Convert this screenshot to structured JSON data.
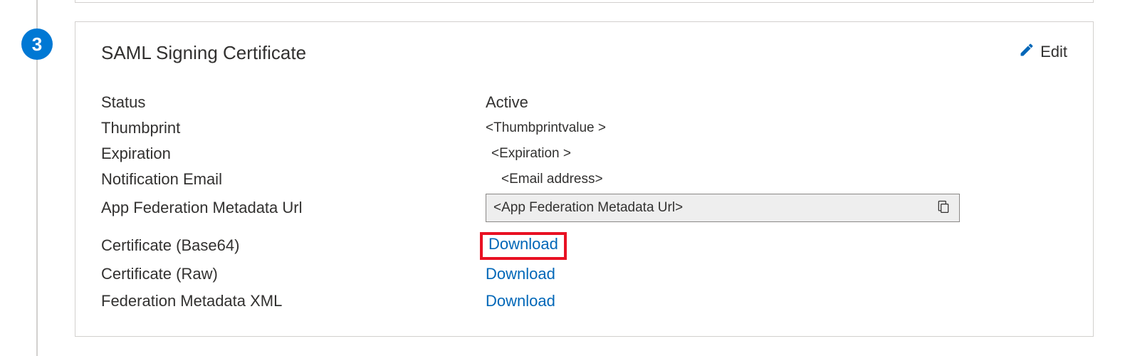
{
  "step": {
    "number": "3"
  },
  "card": {
    "title": "SAML Signing Certificate",
    "edit_label": "Edit"
  },
  "fields": {
    "status": {
      "label": "Status",
      "value": "Active"
    },
    "thumbprint": {
      "label": "Thumbprint",
      "value": "<Thumbprintvalue >"
    },
    "expiration": {
      "label": "Expiration",
      "value": "<Expiration >"
    },
    "notification_email": {
      "label": "Notification Email",
      "value": "<Email address>"
    },
    "metadata_url": {
      "label": "App Federation Metadata Url",
      "value": "<App Federation Metadata Url>"
    },
    "cert_base64": {
      "label": "Certificate (Base64)",
      "action": "Download"
    },
    "cert_raw": {
      "label": "Certificate (Raw)",
      "action": "Download"
    },
    "fed_xml": {
      "label": "Federation Metadata XML",
      "action": "Download"
    }
  }
}
